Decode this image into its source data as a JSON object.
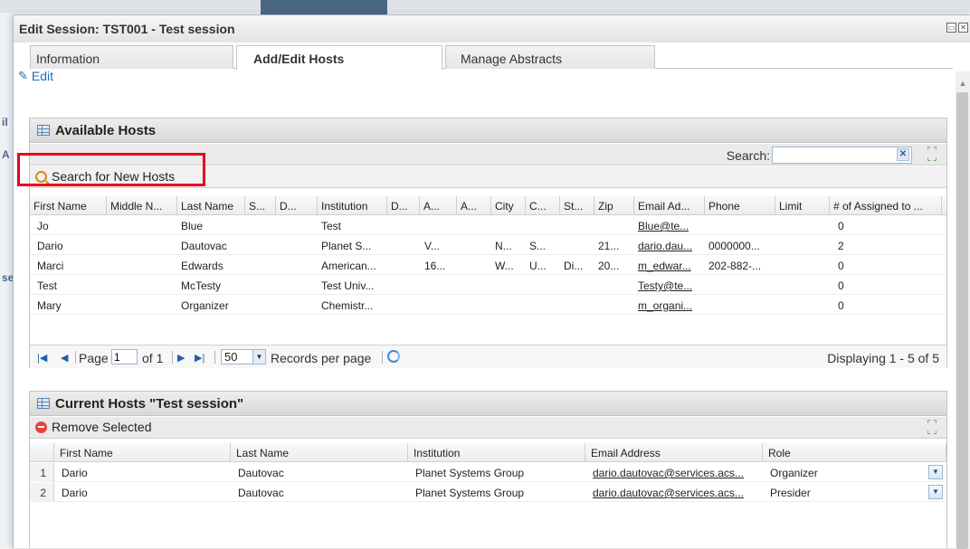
{
  "window": {
    "title": "Edit Session: TST001 - Test session",
    "controls": [
      "restore-icon",
      "close-icon"
    ]
  },
  "tabs": [
    {
      "label": "Information",
      "active": false
    },
    {
      "label": "Add/Edit Hosts",
      "active": true
    },
    {
      "label": "Manage Abstracts",
      "active": false
    }
  ],
  "edit_link": "Edit",
  "available_hosts": {
    "title": "Available Hosts",
    "search_label": "Search:",
    "search_value": "",
    "search_new_label": "Search for New Hosts",
    "columns": [
      "First Name",
      "Middle N...",
      "Last Name",
      "S...",
      "D...",
      "Institution",
      "D...",
      "A...",
      "A...",
      "City",
      "C...",
      "St...",
      "Zip",
      "Email Ad...",
      "Phone",
      "Limit",
      "# of Assigned to ..."
    ],
    "rows": [
      {
        "first": "Jo",
        "middle": "",
        "last": "Blue",
        "s": "",
        "d": "",
        "institution": "Test",
        "d2": "",
        "a1": "",
        "a2": "",
        "city": "",
        "c": "",
        "st": "",
        "zip": "",
        "email": "Blue@te...",
        "phone": "",
        "limit": "",
        "assigned": "0"
      },
      {
        "first": "Dario",
        "middle": "",
        "last": "Dautovac",
        "s": "",
        "d": "",
        "institution": "Planet S...",
        "d2": "",
        "a1": "V...",
        "a2": "",
        "city": "N...",
        "c": "S...",
        "st": "",
        "zip": "21...",
        "email": "dario.dau...",
        "phone": "0000000...",
        "limit": "",
        "assigned": "2"
      },
      {
        "first": "Marci",
        "middle": "",
        "last": "Edwards",
        "s": "",
        "d": "",
        "institution": "American...",
        "d2": "",
        "a1": "16...",
        "a2": "",
        "city": "W...",
        "c": "U...",
        "st": "Di...",
        "zip": "20...",
        "email": "m_edwar...",
        "phone": "202-882-...",
        "limit": "",
        "assigned": "0"
      },
      {
        "first": "Test",
        "middle": "",
        "last": "McTesty",
        "s": "",
        "d": "",
        "institution": "Test Univ...",
        "d2": "",
        "a1": "",
        "a2": "",
        "city": "",
        "c": "",
        "st": "",
        "zip": "",
        "email": "Testy@te...",
        "phone": "",
        "limit": "",
        "assigned": "0"
      },
      {
        "first": "Mary",
        "middle": "",
        "last": "Organizer",
        "s": "",
        "d": "",
        "institution": "Chemistr...",
        "d2": "",
        "a1": "",
        "a2": "",
        "city": "",
        "c": "",
        "st": "",
        "zip": "",
        "email": "m_organi...",
        "phone": "",
        "limit": "",
        "assigned": "0"
      }
    ],
    "pager": {
      "page_label": "Page",
      "page_value": "1",
      "of_label": "of 1",
      "per_page_value": "50",
      "per_page_label": "Records per page",
      "display": "Displaying 1 - 5 of 5"
    }
  },
  "current_hosts": {
    "title": "Current Hosts \"Test session\"",
    "remove_label": "Remove Selected",
    "columns": [
      "First Name",
      "Last Name",
      "Institution",
      "Email Address",
      "Role"
    ],
    "rows": [
      {
        "num": "1",
        "first": "Dario",
        "last": "Dautovac",
        "institution": "Planet Systems Group",
        "email": "dario.dautovac@services.acs...",
        "role": "Organizer"
      },
      {
        "num": "2",
        "first": "Dario",
        "last": "Dautovac",
        "institution": "Planet Systems Group",
        "email": "dario.dautovac@services.acs...",
        "role": "Presider"
      }
    ]
  }
}
